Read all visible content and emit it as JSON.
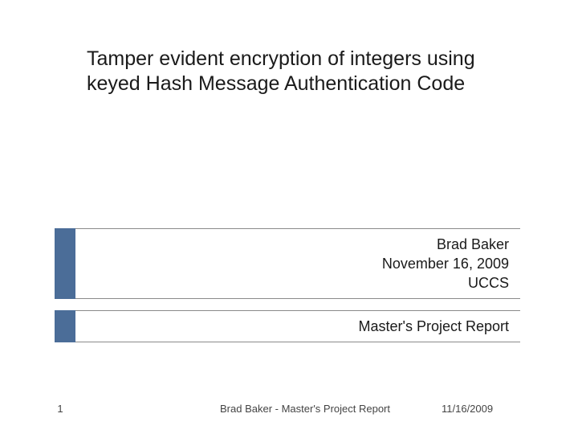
{
  "title": "Tamper evident encryption of integers using keyed Hash Message Authentication Code",
  "author": {
    "name": "Brad Baker",
    "date": "November 16, 2009",
    "org": "UCCS"
  },
  "subtitle": "Master's Project Report",
  "footer": {
    "page": "1",
    "center": "Brad Baker - Master's Project Report",
    "date": "11/16/2009"
  },
  "colors": {
    "accent": "#4b6d98"
  }
}
